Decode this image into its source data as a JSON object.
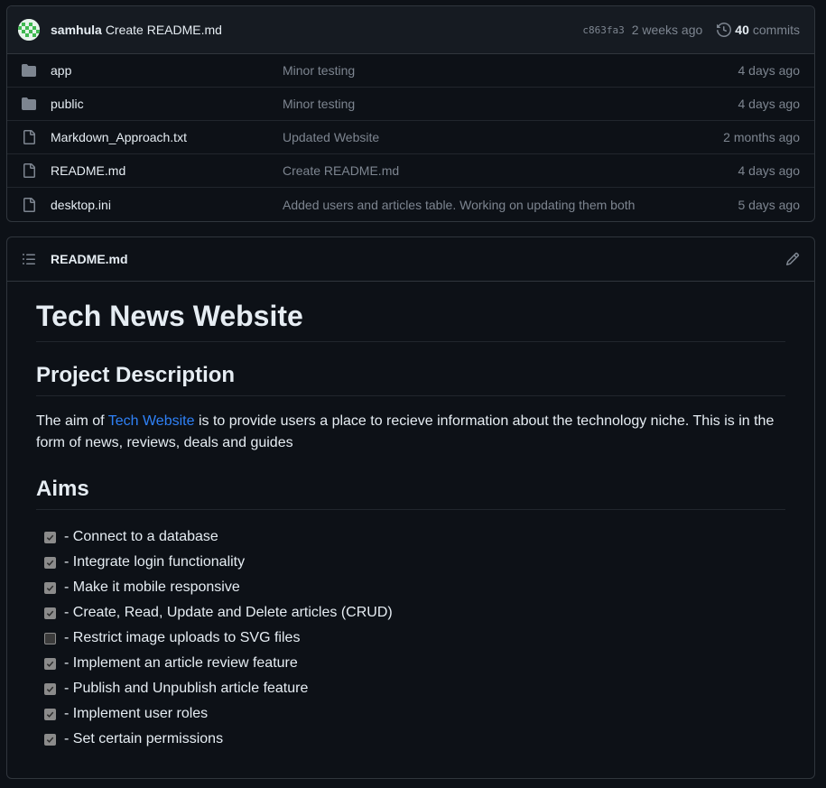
{
  "commit_bar": {
    "author": "samhula",
    "message": "Create README.md",
    "sha": "c863fa3",
    "age": "2 weeks ago",
    "commit_count": "40",
    "commits_label": "commits"
  },
  "files": [
    {
      "type": "folder",
      "icon": "folder-icon",
      "name": "app",
      "commit": "Minor testing",
      "age": "4 days ago"
    },
    {
      "type": "folder",
      "icon": "folder-icon",
      "name": "public",
      "commit": "Minor testing",
      "age": "4 days ago"
    },
    {
      "type": "file",
      "icon": "file-icon",
      "name": "Markdown_Approach.txt",
      "commit": "Updated Website",
      "age": "2 months ago"
    },
    {
      "type": "file",
      "icon": "file-icon",
      "name": "README.md",
      "commit": "Create README.md",
      "age": "4 days ago"
    },
    {
      "type": "file",
      "icon": "file-icon",
      "name": "desktop.ini",
      "commit": "Added users and articles table. Working on updating them both",
      "age": "5 days ago"
    }
  ],
  "readme": {
    "filename": "README.md",
    "title": "Tech News Website",
    "section_description": "Project Description",
    "description_before_link": "The aim of ",
    "description_link": "Tech Website",
    "description_after_link": " is to provide users a place to recieve information about the technology niche. This is in the form of news, reviews, deals and guides",
    "section_aims": "Aims",
    "aims": [
      {
        "text": "- Connect to a database",
        "checked": true
      },
      {
        "text": "- Integrate login functionality",
        "checked": true
      },
      {
        "text": "- Make it mobile responsive",
        "checked": true
      },
      {
        "text": "- Create, Read, Update and Delete articles (CRUD)",
        "checked": true
      },
      {
        "text": "- Restrict image uploads to SVG files",
        "checked": false
      },
      {
        "text": "- Implement an article review feature",
        "checked": true
      },
      {
        "text": "- Publish and Unpublish article feature",
        "checked": true
      },
      {
        "text": "- Implement user roles",
        "checked": true
      },
      {
        "text": "- Set certain permissions",
        "checked": true
      }
    ]
  },
  "colors": {
    "background": "#0d1117",
    "border": "#30363d",
    "text": "#e6edf3",
    "muted": "#7d8590",
    "link": "#2f81f7",
    "icon": "#7d8590"
  }
}
